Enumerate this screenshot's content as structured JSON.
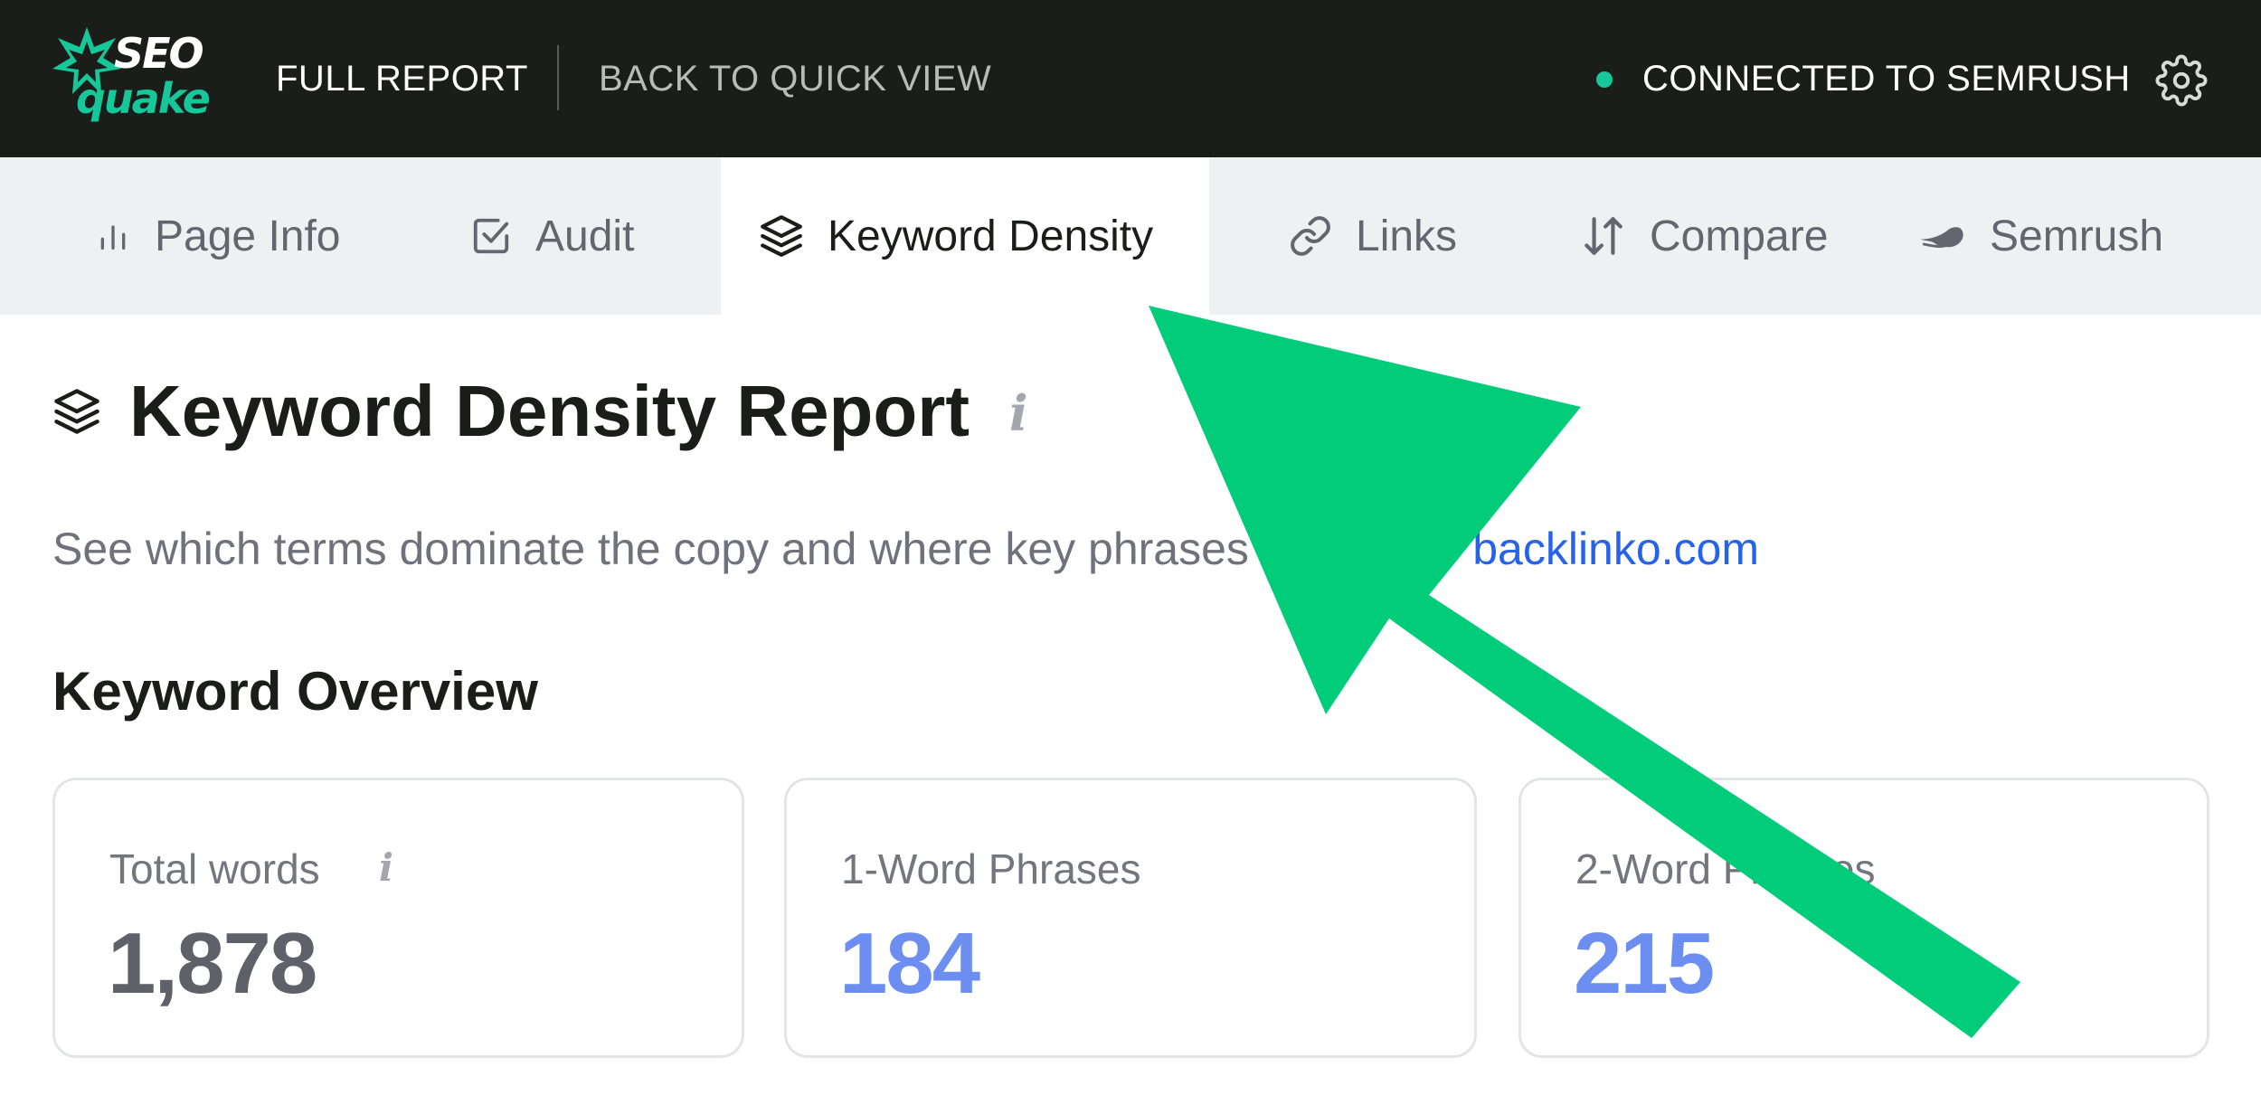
{
  "topbar": {
    "logo_seo": "SEO",
    "logo_quake": "quake",
    "full_report": "FULL REPORT",
    "back_to_quick_view": "BACK TO QUICK VIEW",
    "connection_status": "CONNECTED TO SEMRUSH",
    "connection_color": "#16c79a",
    "settings_icon": "gear-icon"
  },
  "tabs": [
    {
      "label": "Page Info",
      "icon": "bar-chart-icon",
      "active": false
    },
    {
      "label": "Audit",
      "icon": "checkbox-icon",
      "active": false
    },
    {
      "label": "Keyword Density",
      "icon": "layers-icon",
      "active": true
    },
    {
      "label": "Links",
      "icon": "link-icon",
      "active": false
    },
    {
      "label": "Compare",
      "icon": "sort-arrows-icon",
      "active": false
    },
    {
      "label": "Semrush",
      "icon": "semrush-icon",
      "active": false
    }
  ],
  "report": {
    "title": "Keyword Density Report",
    "info_glyph": "i",
    "subtitle_prefix": "See which terms dominate the copy and where key phrases cluster for ",
    "subtitle_link": "backlinko.com",
    "section_title": "Keyword Overview"
  },
  "cards": [
    {
      "label": "Total words",
      "value": "1,878",
      "info_glyph": "i"
    },
    {
      "label": "1-Word Phrases",
      "value": "184"
    },
    {
      "label": "2-Word Phrases",
      "value": "215"
    }
  ],
  "colors": {
    "topbar_bg": "#1b1d1a",
    "accent_green": "#16c79a",
    "arrow_green": "#00cc7a",
    "link_blue": "#2563eb",
    "value_blue": "#6b8ef0"
  }
}
